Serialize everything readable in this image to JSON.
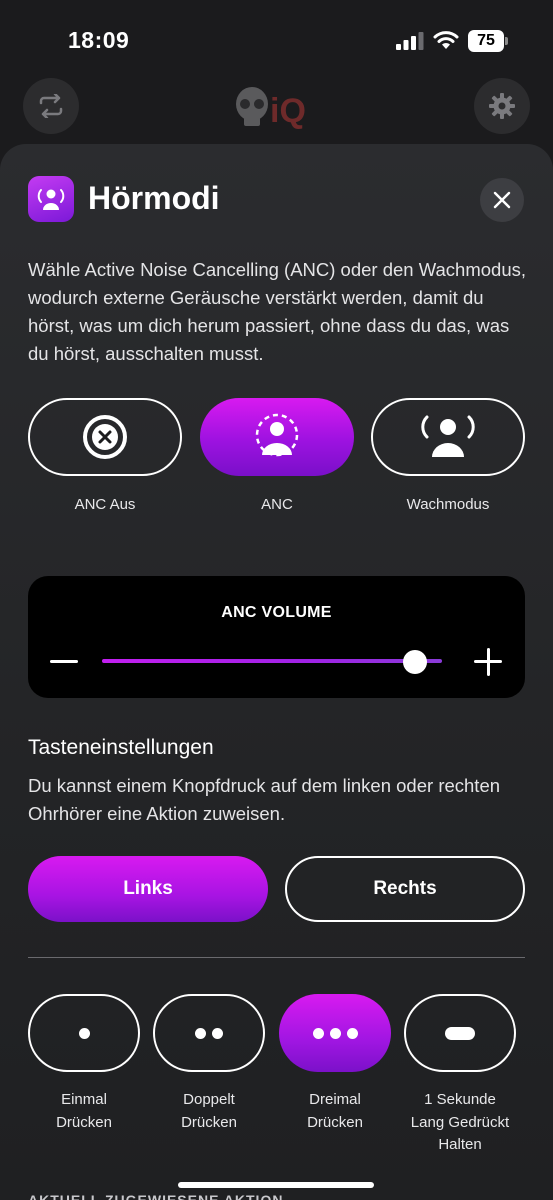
{
  "status_bar": {
    "time": "18:09",
    "battery": "75"
  },
  "header": {
    "logo_text": "iQ"
  },
  "sheet": {
    "title": "Hörmodi",
    "description": "Wähle Active Noise Cancelling (ANC) oder den Wachmodus, wodurch externe Geräusche verstärkt werden, damit du hörst, was um dich herum passiert, ohne dass du das, was du hörst, ausschalten musst.",
    "modes": [
      {
        "label": "ANC Aus",
        "icon": "anc-off-icon",
        "selected": false
      },
      {
        "label": "ANC",
        "icon": "anc-icon",
        "selected": true
      },
      {
        "label": "Wachmodus",
        "icon": "awareness-icon",
        "selected": false
      }
    ],
    "anc_volume": {
      "title": "ANC VOLUME",
      "level": 0.92
    },
    "button_settings": {
      "title": "Tasteneinstellungen",
      "description": "Du kannst einem Knopfdruck auf dem linken oder rechten Ohrhörer eine Aktion zuweisen.",
      "sides": [
        {
          "label": "Links",
          "selected": true
        },
        {
          "label": "Rechts",
          "selected": false
        }
      ],
      "presses": [
        {
          "label_line1": "Einmal",
          "label_line2": "Drücken",
          "label_line3": "",
          "selected": false
        },
        {
          "label_line1": "Doppelt",
          "label_line2": "Drücken",
          "label_line3": "",
          "selected": false
        },
        {
          "label_line1": "Dreimal",
          "label_line2": "Drücken",
          "label_line3": "",
          "selected": true
        },
        {
          "label_line1": "1 Sekunde",
          "label_line2": "Lang Gedrückt",
          "label_line3": "Halten",
          "selected": false
        }
      ],
      "next_section_cut": "AKTUELL ZUGEWIESENE AKTION"
    }
  },
  "colors": {
    "accent": "#c21ff0",
    "accent_dark": "#7b11c9",
    "background": "#1b1b1d",
    "sheet": "#2b2c2f"
  }
}
